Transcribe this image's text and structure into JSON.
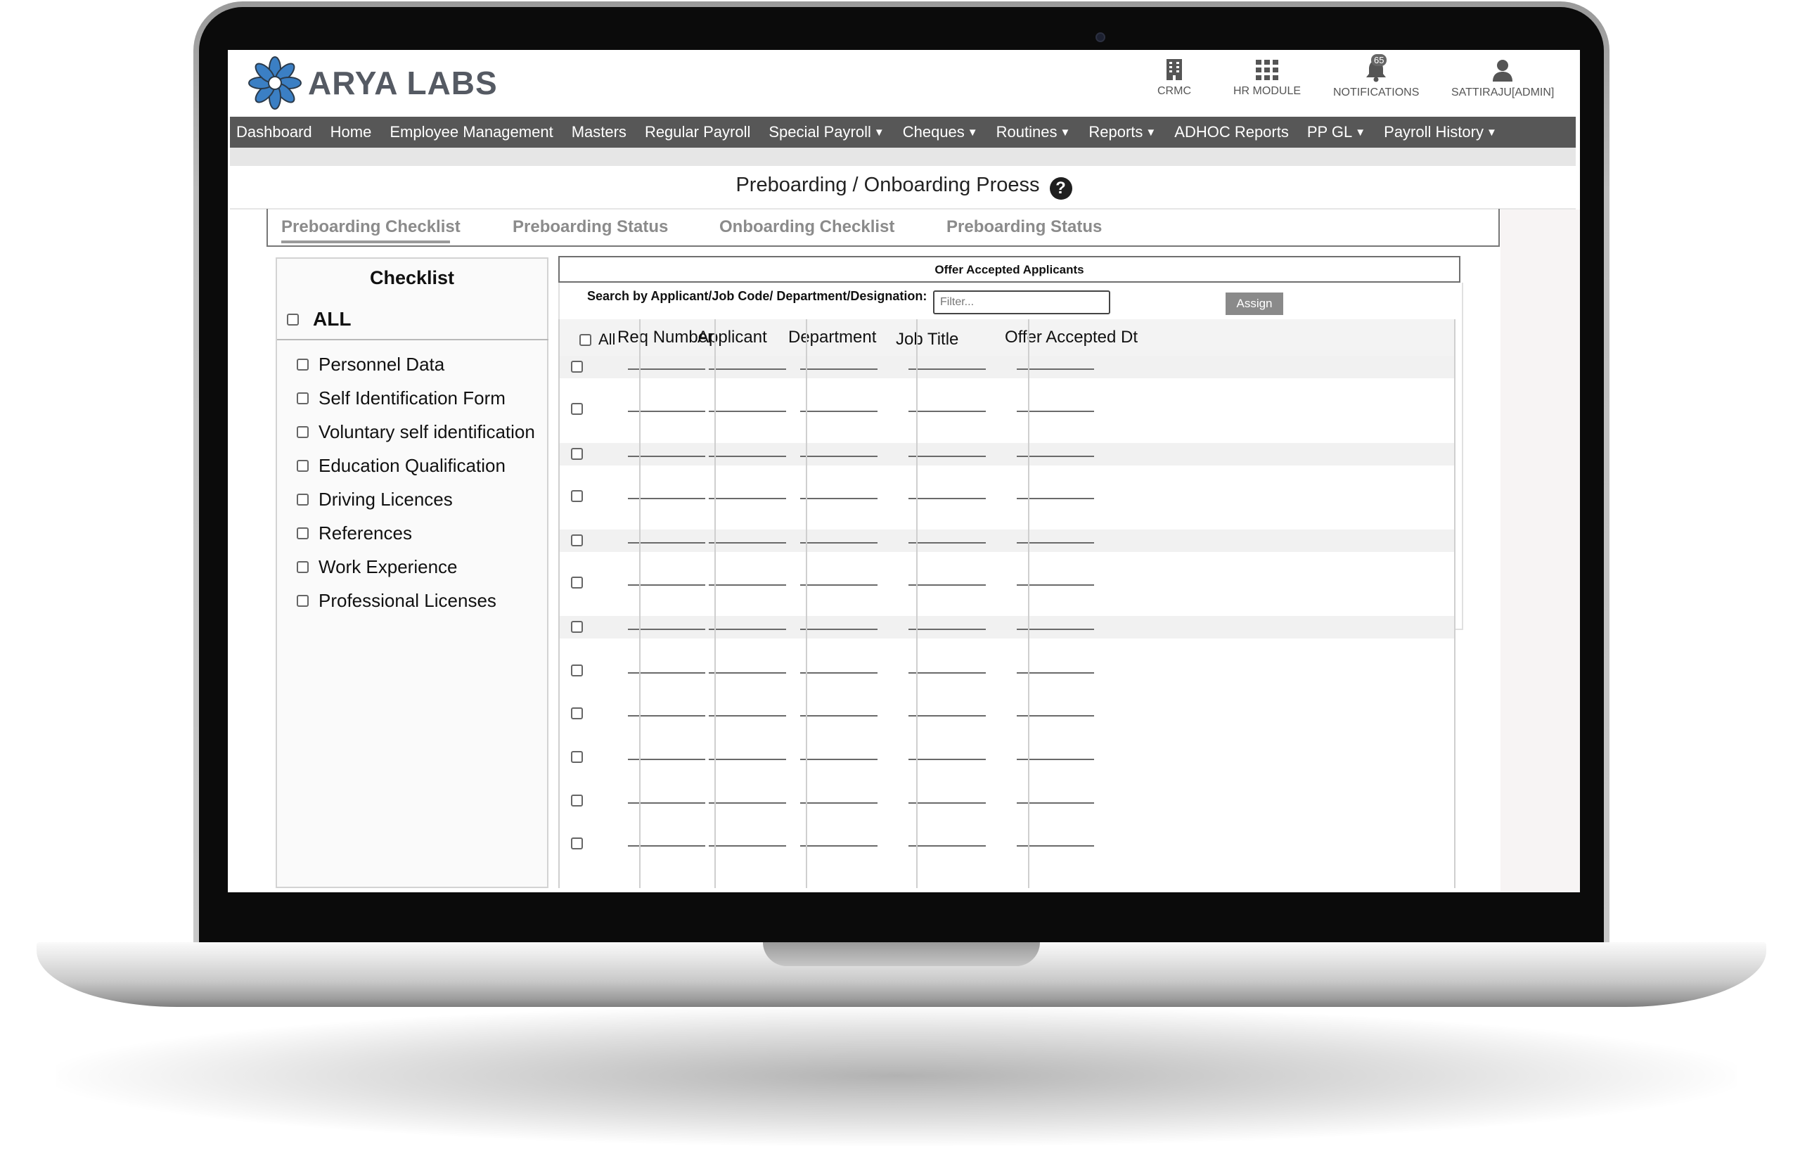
{
  "app": {
    "logo_text": "ARYA LABS",
    "header_icons": [
      {
        "label": "CRMC",
        "icon": "building-icon"
      },
      {
        "label": "HR MODULE",
        "icon": "grid-icon"
      },
      {
        "label": "NOTIFICATIONS",
        "icon": "bell-icon",
        "badge": "65"
      },
      {
        "label": "SATTIRAJU[ADMIN]",
        "icon": "user-icon"
      }
    ]
  },
  "nav": {
    "items": [
      {
        "label": "Dashboard",
        "dropdown": false
      },
      {
        "label": "Home",
        "dropdown": false
      },
      {
        "label": "Employee Management",
        "dropdown": false
      },
      {
        "label": "Masters",
        "dropdown": false
      },
      {
        "label": "Regular Payroll",
        "dropdown": false
      },
      {
        "label": "Special Payroll",
        "dropdown": true
      },
      {
        "label": "Cheques",
        "dropdown": true
      },
      {
        "label": "Routines",
        "dropdown": true
      },
      {
        "label": "Reports",
        "dropdown": true
      },
      {
        "label": "ADHOC Reports",
        "dropdown": false
      },
      {
        "label": "PP GL",
        "dropdown": true
      },
      {
        "label": "Payroll History",
        "dropdown": true
      }
    ]
  },
  "page": {
    "title": "Preboarding / Onboarding Proess",
    "help_glyph": "?"
  },
  "tabs": [
    {
      "label": "Preboarding Checklist",
      "active": true
    },
    {
      "label": "Preboarding Status",
      "active": false
    },
    {
      "label": "Onboarding Checklist",
      "active": false
    },
    {
      "label": "Preboarding Status",
      "active": false
    }
  ],
  "checklist": {
    "title": "Checklist",
    "all_label": "ALL",
    "items": [
      "Personnel Data",
      "Self Identification Form",
      "Voluntary self identification",
      "Education Qualification",
      "Driving Licences",
      "References",
      "Work Experience",
      "Professional Licenses"
    ]
  },
  "applicants": {
    "title": "Offer Accepted Applicants",
    "search_label": "Search by Applicant/Job Code/ Department/Designation:",
    "search_placeholder": "Filter...",
    "search_value": "",
    "assign_label": "Assign",
    "select_all_label": "All",
    "columns": [
      "Req Number",
      "Applicant",
      "Department",
      "Job Title",
      "Offer Accepted Dt"
    ],
    "row_count": 12
  },
  "colors": {
    "nav_bg": "#575757",
    "tab_text": "#8b8b8b",
    "assign_bg": "#8a8a8a",
    "logo_blue": "#3b7fc4"
  }
}
